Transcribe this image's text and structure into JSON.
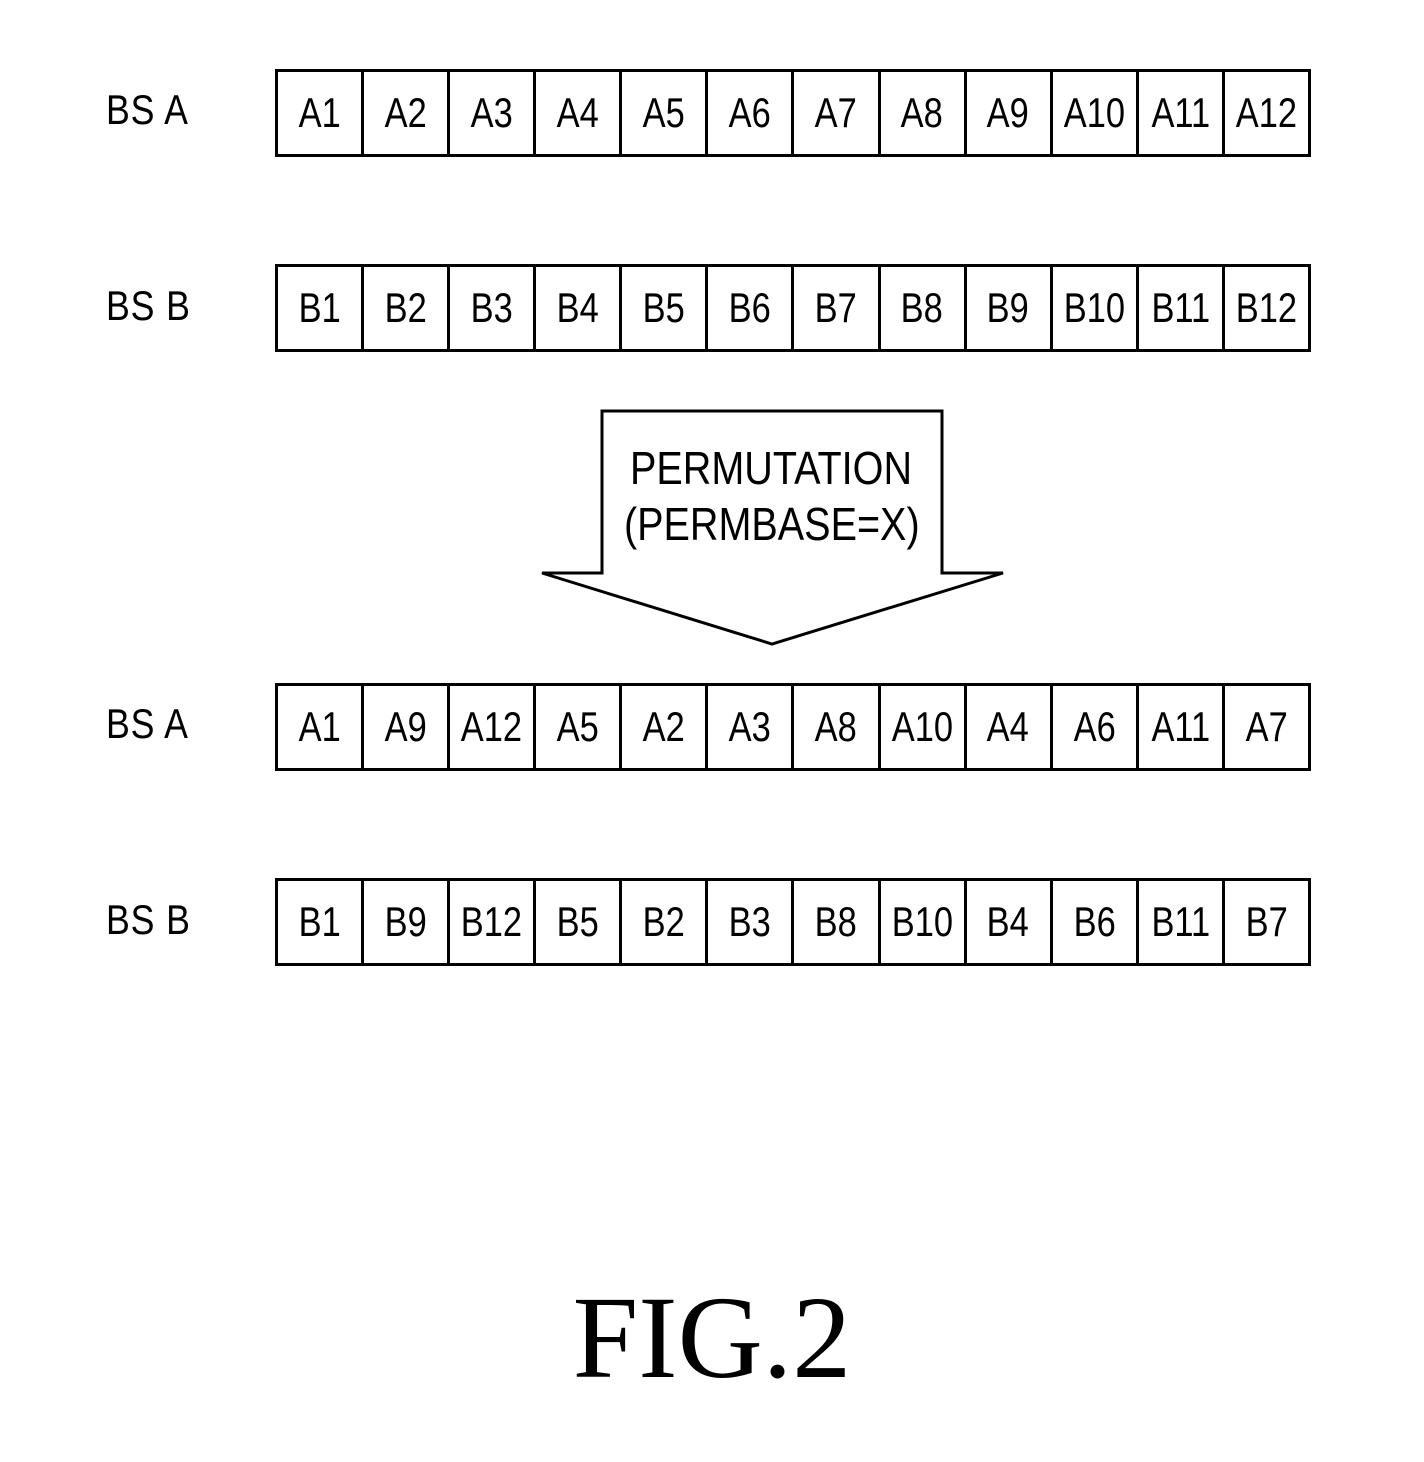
{
  "rows": [
    {
      "label": "BS A",
      "cells": [
        "A1",
        "A2",
        "A3",
        "A4",
        "A5",
        "A6",
        "A7",
        "A8",
        "A9",
        "A10",
        "A11",
        "A12"
      ]
    },
    {
      "label": "BS B",
      "cells": [
        "B1",
        "B2",
        "B3",
        "B4",
        "B5",
        "B6",
        "B7",
        "B8",
        "B9",
        "B10",
        "B11",
        "B12"
      ]
    },
    {
      "label": "BS A",
      "cells": [
        "A1",
        "A9",
        "A12",
        "A5",
        "A2",
        "A3",
        "A8",
        "A10",
        "A4",
        "A6",
        "A11",
        "A7"
      ]
    },
    {
      "label": "BS B",
      "cells": [
        "B1",
        "B9",
        "B12",
        "B5",
        "B2",
        "B3",
        "B8",
        "B10",
        "B4",
        "B6",
        "B11",
        "B7"
      ]
    }
  ],
  "arrow": {
    "line1": "PERMUTATION",
    "line2": "(PERMBASE=X)"
  },
  "figure_caption": "FIG.2"
}
